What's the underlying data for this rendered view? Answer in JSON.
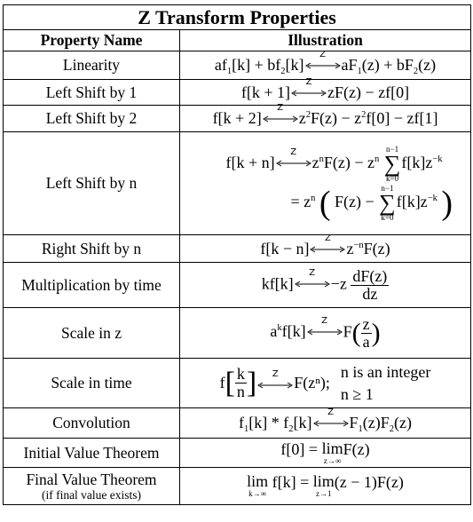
{
  "title": "Z Transform Properties",
  "headers": {
    "property": "Property Name",
    "illustration": "Illustration"
  },
  "transform_label": "Z",
  "rows": [
    {
      "name": "Linearity",
      "lhs": "af₁[k] + bf₂[k]",
      "rhs": "aF₁(z) + bF₂(z)"
    },
    {
      "name": "Left Shift by 1",
      "lhs": "f[k + 1]",
      "rhs": "zF(z) − zf[0]"
    },
    {
      "name": "Left Shift by 2",
      "lhs": "f[k + 2]",
      "rhs": "z²F(z) − z²f[0] − zf[1]"
    },
    {
      "name": "Left Shift by n",
      "lhs": "f[k + n]",
      "rhs": "zⁿF(z) − zⁿ ∑_{k=0}^{n−1} f[k]z⁻ᵏ",
      "rhs2": "= zⁿ ( F(z) − ∑_{k=0}^{n−1} f[k]z⁻ᵏ )",
      "sum_upper": "n−1",
      "sum_lower": "k=0"
    },
    {
      "name": "Right Shift by n",
      "lhs": "f[k − n]",
      "rhs": "z⁻ⁿF(z)"
    },
    {
      "name": "Multiplication by time",
      "lhs": "kf[k]",
      "rhs": "−z dF(z)/dz",
      "frac_num": "dF(z)",
      "frac_den": "dz"
    },
    {
      "name": "Scale in z",
      "lhs": "aᵏf[k]",
      "rhs": "F(z/a)",
      "frac_num": "z",
      "frac_den": "a"
    },
    {
      "name": "Scale in time",
      "lhs": "f[k/n]",
      "rhs": "F(zⁿ);",
      "frac_num": "k",
      "frac_den": "n",
      "notes": [
        "n is an integer",
        "n ≥ 1"
      ]
    },
    {
      "name": "Convolution",
      "lhs": "f₁[k] * f₂[k]",
      "rhs": "F₁(z)F₂(z)"
    },
    {
      "name": "Initial Value Theorem",
      "equation": "f[0] = lim_{z→∞} F(z)",
      "lim_sub": "z→∞"
    },
    {
      "name": "Final Value Theorem",
      "name_note": "(if final value exists)",
      "equation": "lim_{k→∞} f[k] = lim_{z→1} (z − 1)F(z)",
      "lim_sub_1": "k→∞",
      "lim_sub_2": "z→1"
    }
  ],
  "glyphs": {
    "lim": "lim",
    "sigma": "∑",
    "equals": "=",
    "minus": "−"
  }
}
